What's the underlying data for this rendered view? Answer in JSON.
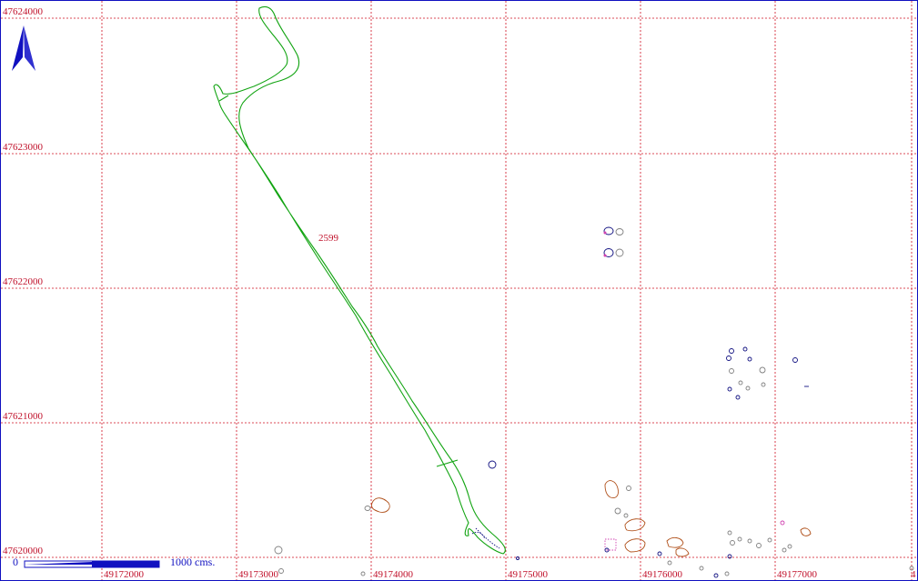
{
  "map": {
    "x_labels": [
      "49172000",
      "49173000",
      "49174000",
      "49175000",
      "49176000",
      "49177000",
      "4"
    ],
    "y_labels": [
      "47624000",
      "47623000",
      "47622000",
      "47621000",
      "47620000"
    ],
    "parcel_label": "2599",
    "scale": {
      "start": "0",
      "end_label": "1000  cms."
    },
    "colors": {
      "grid": "#d01020",
      "parcel": "#12a412",
      "scale": "#1010c0",
      "north_arrow": "#1010c0",
      "labels": "#c0102a",
      "feature_brown": "#b0501a",
      "feature_blue": "#101080",
      "feature_gray": "#808080",
      "feature_pink": "#d040b0"
    },
    "icons": [
      "north-arrow-icon"
    ]
  }
}
